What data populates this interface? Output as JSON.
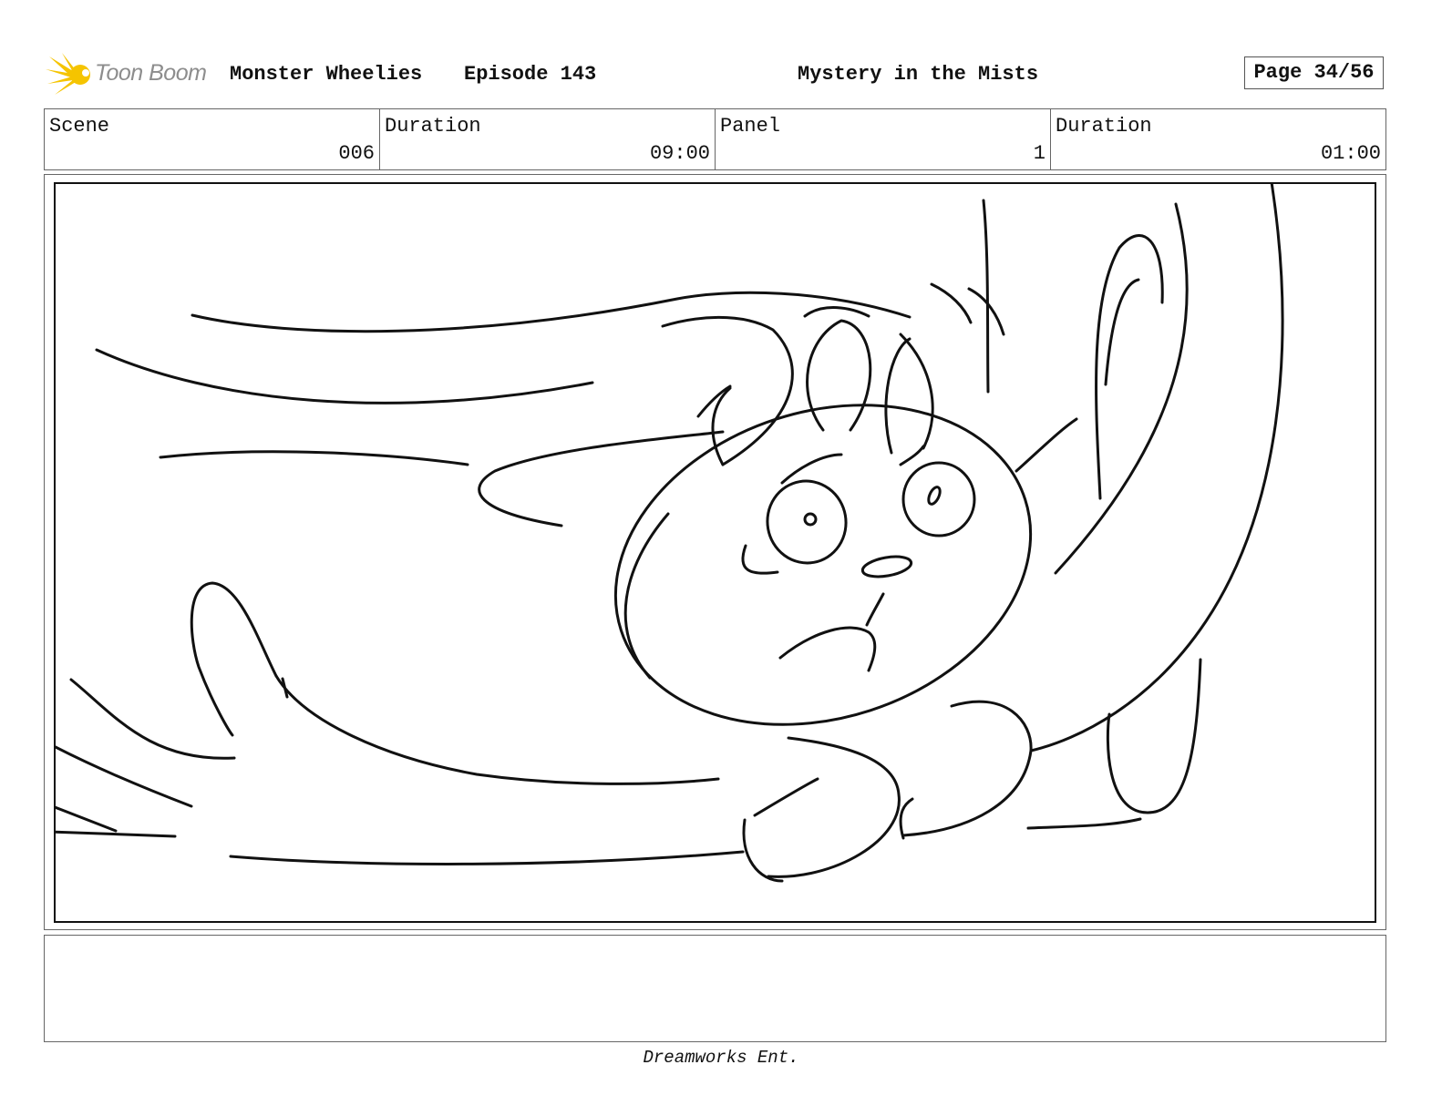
{
  "header": {
    "logo_text": "Toon Boom",
    "show_title": "Monster Wheelies",
    "episode": "Episode 143",
    "episode_title": "Mystery in the Mists",
    "page": "Page 34/56"
  },
  "info": {
    "scene_label": "Scene",
    "scene_value": "006",
    "scene_duration_label": "Duration",
    "scene_duration_value": "09:00",
    "panel_label": "Panel",
    "panel_value": "1",
    "panel_duration_label": "Duration",
    "panel_duration_value": "01:00"
  },
  "notes": {
    "text": ""
  },
  "footer": {
    "text": "Dreamworks Ent."
  },
  "colors": {
    "logo_accent": "#f5c400",
    "logo_text": "#8d8d8d",
    "ink": "#111111"
  }
}
